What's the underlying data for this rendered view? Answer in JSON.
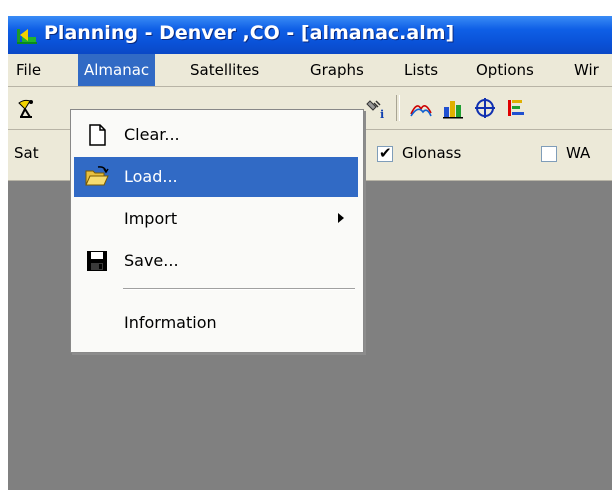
{
  "window": {
    "title": "Planning - Denver ,CO - [almanac.alm]"
  },
  "menubar": {
    "items": [
      "File",
      "Almanac",
      "Satellites",
      "Graphs",
      "Lists",
      "Options",
      "Wir"
    ],
    "active": "Almanac"
  },
  "filterbar": {
    "sat_label": "Sat",
    "glonass_label": "Glonass",
    "glonass_checked": true,
    "wa_label": "WA",
    "wa_checked": false
  },
  "almanac_menu": {
    "items": [
      {
        "label": "Clear...",
        "icon": "new-document-icon"
      },
      {
        "label": "Load...",
        "icon": "open-folder-icon",
        "highlighted": true
      },
      {
        "label": "Import",
        "submenu": true
      },
      {
        "label": "Save...",
        "icon": "floppy-disk-icon"
      },
      {
        "label": "Information"
      }
    ]
  },
  "toolbar": {
    "icons": [
      "satellite-dish-icon",
      "satellite-info-icon",
      "elevation-graph-icon",
      "bar-chart-icon",
      "sky-plot-icon",
      "color-bars-icon"
    ]
  },
  "colors": {
    "titlebar": "#0a52d8",
    "menu_highlight": "#316ac5",
    "workspace": "#808080",
    "chrome": "#ece9d8"
  }
}
